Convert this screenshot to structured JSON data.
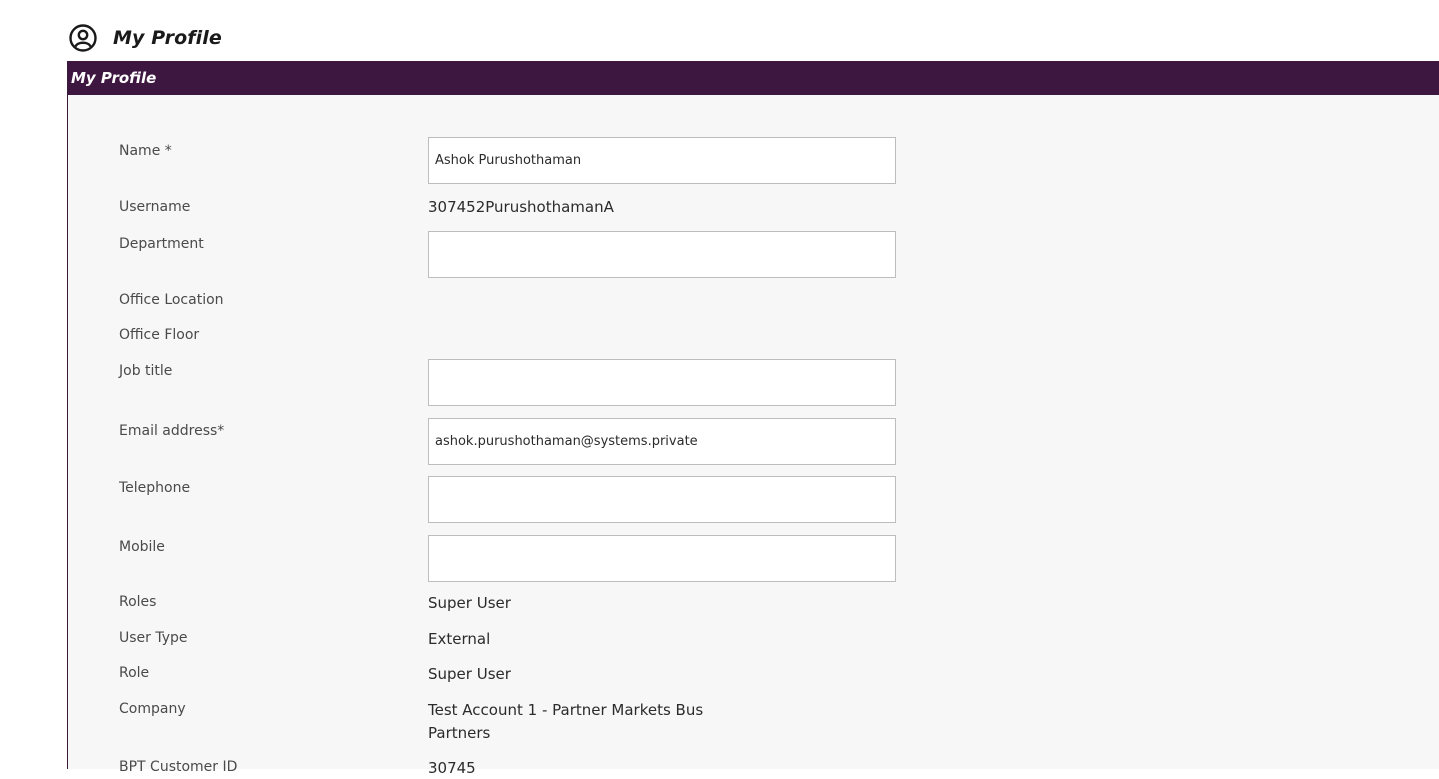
{
  "header": {
    "title": "My Profile",
    "icon": "user-circle-icon"
  },
  "panel": {
    "title": "My Profile",
    "header_color": "#3e1740"
  },
  "fields": {
    "name": {
      "label": "Name *",
      "value": "Ashok Purushothaman"
    },
    "username": {
      "label": "Username",
      "value": "307452PurushothamanA"
    },
    "department": {
      "label": "Department",
      "value": ""
    },
    "office_location": {
      "label": "Office Location",
      "value": ""
    },
    "office_floor": {
      "label": "Office Floor",
      "value": ""
    },
    "job_title": {
      "label": "Job title",
      "value": ""
    },
    "email": {
      "label": "Email address*",
      "value": "ashok.purushothaman@systems.private"
    },
    "telephone": {
      "label": "Telephone",
      "value": ""
    },
    "mobile": {
      "label": "Mobile",
      "value": ""
    },
    "roles": {
      "label": "Roles",
      "value": "Super User"
    },
    "user_type": {
      "label": "User Type",
      "value": "External"
    },
    "role": {
      "label": "Role",
      "value": "Super User"
    },
    "company": {
      "label": "Company",
      "value_line1": "Test Account 1 - Partner Markets Bus",
      "value_line2": "Partners"
    },
    "customer_id": {
      "label": "BPT Customer ID",
      "value": "30745"
    }
  }
}
